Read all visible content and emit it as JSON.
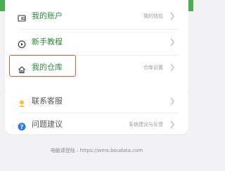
{
  "menu_primary": [
    {
      "label": "我的账户",
      "side": "我的钱包",
      "icon": "wallet-icon"
    },
    {
      "label": "新手教程",
      "side": "",
      "icon": "play-circle-icon"
    },
    {
      "label": "我的仓库",
      "side": "仓库设置",
      "icon": "home-icon"
    }
  ],
  "menu_secondary": [
    {
      "label": "联系客服",
      "side": "",
      "icon": "customer-service-icon"
    },
    {
      "label": "问题建议",
      "side": "系统建议与反馈",
      "icon": "question-icon"
    }
  ],
  "footer": {
    "text": "电脑请登陆 : https://wms.boudata.com"
  },
  "colors": {
    "primary_green": "#2c8a3a",
    "highlight_red": "#e2553c",
    "help_blue": "#2d7be6",
    "service_yellow": "#f2c230"
  }
}
